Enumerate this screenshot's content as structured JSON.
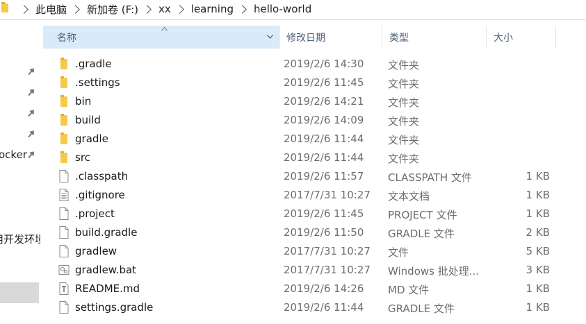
{
  "breadcrumb": [
    "此电脑",
    "新加卷 (F:)",
    "xx",
    "learning",
    "hello-world"
  ],
  "nav": {
    "partial_items": [
      {
        "label": "ocker"
      },
      {
        "label": "用开发环境"
      }
    ]
  },
  "columns": {
    "name": "名称",
    "date": "修改日期",
    "type": "类型",
    "size": "大小"
  },
  "files": [
    {
      "name": ".gradle",
      "date": "2019/2/6 14:30",
      "type": "文件夹",
      "size": "",
      "icon": "folder-icon"
    },
    {
      "name": ".settings",
      "date": "2019/2/6 11:45",
      "type": "文件夹",
      "size": "",
      "icon": "folder-icon"
    },
    {
      "name": "bin",
      "date": "2019/2/6 14:21",
      "type": "文件夹",
      "size": "",
      "icon": "folder-icon"
    },
    {
      "name": "build",
      "date": "2019/2/6 14:09",
      "type": "文件夹",
      "size": "",
      "icon": "folder-icon"
    },
    {
      "name": "gradle",
      "date": "2019/2/6 11:44",
      "type": "文件夹",
      "size": "",
      "icon": "folder-icon"
    },
    {
      "name": "src",
      "date": "2019/2/6 11:44",
      "type": "文件夹",
      "size": "",
      "icon": "folder-icon"
    },
    {
      "name": ".classpath",
      "date": "2019/2/6 11:57",
      "type": "CLASSPATH 文件",
      "size": "1 KB",
      "icon": "file-icon"
    },
    {
      "name": ".gitignore",
      "date": "2017/7/31 10:27",
      "type": "文本文档",
      "size": "1 KB",
      "icon": "text-file-icon"
    },
    {
      "name": ".project",
      "date": "2019/2/6 11:45",
      "type": "PROJECT 文件",
      "size": "1 KB",
      "icon": "file-icon"
    },
    {
      "name": "build.gradle",
      "date": "2019/2/6 11:50",
      "type": "GRADLE 文件",
      "size": "2 KB",
      "icon": "file-icon"
    },
    {
      "name": "gradlew",
      "date": "2017/7/31 10:27",
      "type": "文件",
      "size": "5 KB",
      "icon": "file-icon"
    },
    {
      "name": "gradlew.bat",
      "date": "2017/7/31 10:27",
      "type": "Windows 批处理...",
      "size": "3 KB",
      "icon": "batch-file-icon"
    },
    {
      "name": "README.md",
      "date": "2019/2/6 14:26",
      "type": "MD 文件",
      "size": "1 KB",
      "icon": "markdown-file-icon"
    },
    {
      "name": "settings.gradle",
      "date": "2019/2/6 11:44",
      "type": "GRADLE 文件",
      "size": "1 KB",
      "icon": "file-icon"
    }
  ],
  "colors": {
    "folder": "#f7c948",
    "header_selected": "#d9ebf9",
    "nav_selected": "#d9d9d9",
    "secondary_text": "#6d6d6d",
    "header_text": "#4c607a"
  }
}
